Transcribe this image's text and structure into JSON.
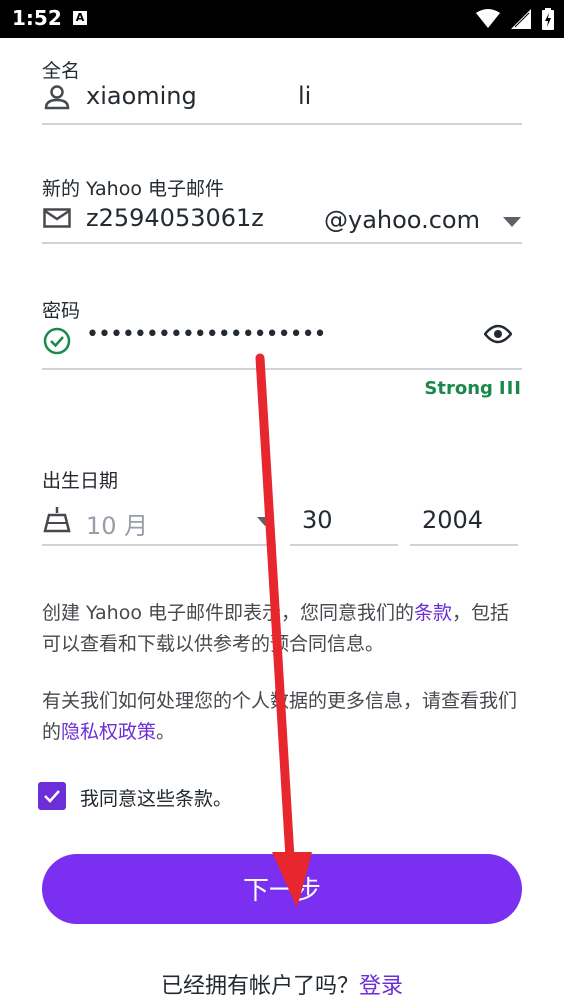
{
  "status_bar": {
    "time": "1:52",
    "notification_icon": "A"
  },
  "full_name": {
    "label": "全名",
    "first": "xiaoming",
    "last": "li"
  },
  "email": {
    "label": "新的 Yahoo 电子邮件",
    "username": "z2594053061z",
    "domain": "@yahoo.com"
  },
  "password": {
    "label": "密码",
    "masked_value": "••••••••••••••••••••",
    "strength": "Strong",
    "strength_bars": "III"
  },
  "birthday": {
    "label": "出生日期",
    "month": "10 月",
    "day": "30",
    "year": "2004"
  },
  "terms": {
    "line1_prefix": "创建 Yahoo 电子邮件即表示，您同意我们的",
    "terms_link": "条款",
    "line1_suffix": "，包括可以查看和下载以供参考的预合同信息。",
    "line2_prefix": "有关我们如何处理您的个人数据的更多信息，请查看我们的",
    "privacy_link": "隐私权政策",
    "line2_suffix": "。"
  },
  "agree": {
    "label": "我同意这些条款。",
    "checked": true
  },
  "next_button": {
    "label": "下一步"
  },
  "footer": {
    "text": "已经拥有帐户了吗？",
    "login_link": "登录"
  },
  "colors": {
    "accent": "#7b2ff0",
    "strong_green": "#1a8a4c",
    "link": "#6c2ed8",
    "annotation_arrow": "#e8262d"
  }
}
